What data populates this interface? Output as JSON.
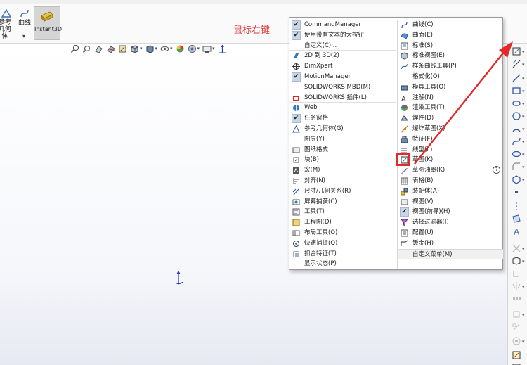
{
  "ribbon": {
    "ref_geometry_label": "参考几何体",
    "curves_label": "曲线",
    "instant3d_label": "Instant3D",
    "right_click_note": "鼠标右键"
  },
  "menu": {
    "left": [
      {
        "label": "CommandManager",
        "checked": true,
        "icon": "check-icon"
      },
      {
        "label": "使用带有文本的大按钮",
        "checked": true,
        "icon": "check-icon"
      },
      {
        "label": "自定义(C)...",
        "checked": false,
        "icon": "none"
      },
      {
        "label": "2D 到 3D(2)",
        "checked": false,
        "icon": "2d-to-3d-icon"
      },
      {
        "label": "DimXpert",
        "checked": false,
        "icon": "dimxpert-icon"
      },
      {
        "label": "MotionManager",
        "checked": true,
        "icon": "check-icon"
      },
      {
        "label": "SOLIDWORKS MBD(M)",
        "checked": false,
        "icon": "none"
      },
      {
        "label": "SOLIDWORKS 插件(L)",
        "checked": false,
        "icon": "addins-icon"
      },
      {
        "label": "Web",
        "checked": false,
        "icon": "globe-icon"
      },
      {
        "label": "任务窗格",
        "checked": true,
        "icon": "check-icon"
      },
      {
        "label": "参考几何体(G)",
        "checked": false,
        "icon": "reference-geometry-icon"
      },
      {
        "label": "图层(Y)",
        "checked": false,
        "icon": "none"
      },
      {
        "label": "图纸格式",
        "checked": false,
        "icon": "sheet-format-icon"
      },
      {
        "label": "块(B)",
        "checked": false,
        "icon": "block-icon"
      },
      {
        "label": "宏(M)",
        "checked": false,
        "icon": "macro-icon"
      },
      {
        "label": "对齐(N)",
        "checked": false,
        "icon": "align-icon"
      },
      {
        "label": "尺寸/几何关系(R)",
        "checked": false,
        "icon": "dimension-icon"
      },
      {
        "label": "屏幕捕获(C)",
        "checked": false,
        "icon": "screen-capture-icon"
      },
      {
        "label": "工具(T)",
        "checked": false,
        "icon": "tools-icon"
      },
      {
        "label": "工程图(D)",
        "checked": false,
        "icon": "drawing-icon"
      },
      {
        "label": "布局工具(O)",
        "checked": false,
        "icon": "layout-tools-icon"
      },
      {
        "label": "快速捕捉(Q)",
        "checked": false,
        "icon": "quick-snap-icon"
      },
      {
        "label": "扣合特征(T)",
        "checked": false,
        "icon": "fastening-feature-icon"
      },
      {
        "label": "显示状态(P)",
        "checked": false,
        "icon": "none"
      }
    ],
    "right": [
      {
        "label": "曲线(C)",
        "checked": false,
        "icon": "curve-icon"
      },
      {
        "label": "曲面(E)",
        "checked": false,
        "icon": "surface-icon"
      },
      {
        "label": "标准(S)",
        "checked": false,
        "icon": "standard-icon"
      },
      {
        "label": "标准视图(E)",
        "checked": false,
        "icon": "standard-views-icon"
      },
      {
        "label": "样条曲线工具(P)",
        "checked": false,
        "icon": "spline-tools-icon"
      },
      {
        "label": "格式化(O)",
        "checked": false,
        "icon": "none"
      },
      {
        "label": "模具工具(O)",
        "checked": false,
        "icon": "mold-tools-icon"
      },
      {
        "label": "注解(N)",
        "checked": false,
        "icon": "annotation-icon"
      },
      {
        "label": "渲染工具(T)",
        "checked": false,
        "icon": "render-tools-icon"
      },
      {
        "label": "焊件(D)",
        "checked": false,
        "icon": "weldments-icon"
      },
      {
        "label": "爆炸草图(X)",
        "checked": false,
        "icon": "explode-sketch-icon"
      },
      {
        "label": "特征(F)",
        "checked": false,
        "icon": "features-icon"
      },
      {
        "label": "线型(L)",
        "checked": false,
        "icon": "line-format-icon"
      },
      {
        "label": "草图(K)",
        "checked": false,
        "icon": "sketch-icon",
        "highlight": true
      },
      {
        "label": "草图油墨(K)",
        "checked": false,
        "icon": "sketch-ink-icon",
        "help": true
      },
      {
        "label": "表格(B)",
        "checked": false,
        "icon": "table-icon"
      },
      {
        "label": "装配体(A)",
        "checked": false,
        "icon": "assembly-icon"
      },
      {
        "label": "视图(V)",
        "checked": false,
        "icon": "view-icon"
      },
      {
        "label": "视图(前导)(H)",
        "checked": true,
        "icon": "check-icon"
      },
      {
        "label": "选择过滤器(I)",
        "checked": false,
        "icon": "selection-filter-icon"
      },
      {
        "label": "配置(U)",
        "checked": false,
        "icon": "configurations-icon"
      },
      {
        "label": "钣金(H)",
        "checked": false,
        "icon": "sheet-metal-icon"
      },
      {
        "label": "自定义菜单(M)",
        "checked": false,
        "icon": "none",
        "footer": true
      }
    ]
  },
  "colors": {
    "accent_red": "#e5282a",
    "note_red": "#e23a3a",
    "check_bg": "#c9d6e6"
  }
}
